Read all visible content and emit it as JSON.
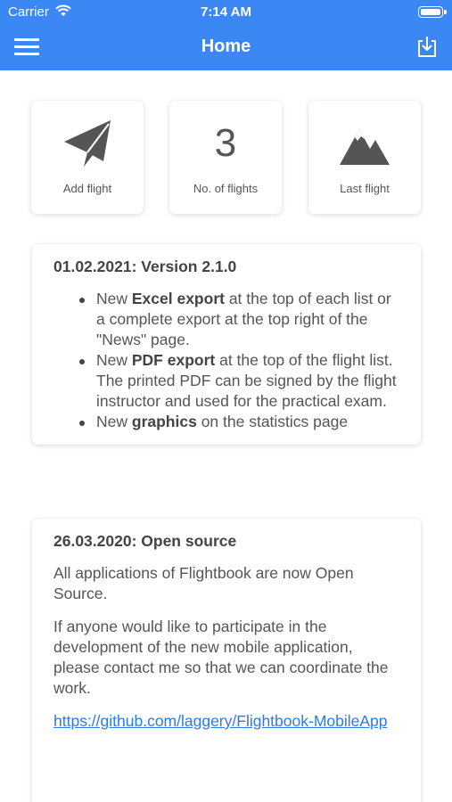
{
  "status_bar": {
    "carrier": "Carrier",
    "time": "7:14 AM"
  },
  "nav": {
    "title": "Home",
    "menu_icon": "hamburger-icon",
    "export_icon": "download-icon"
  },
  "tiles": [
    {
      "label": "Add flight",
      "icon": "paper-plane-icon"
    },
    {
      "label": "No. of flights",
      "count": "3"
    },
    {
      "label": "Last flight",
      "icon": "mountain-icon"
    }
  ],
  "news": [
    {
      "title": "01.02.2021: Version 2.1.0",
      "items": [
        {
          "pre": "New ",
          "bold": "Excel export",
          "post": " at the top of each list or a complete export at the top right of the \"News\" page."
        },
        {
          "pre": "New ",
          "bold": "PDF export",
          "post": " at the top of the flight list.",
          "extra": "The printed PDF can be signed by the flight instructor and used for the practical exam."
        },
        {
          "pre": "New ",
          "bold": "graphics",
          "post": " on the statistics page"
        }
      ]
    },
    {
      "title": "26.03.2020: Open source",
      "paragraphs": [
        "All applications of Flightbook are now Open Source.",
        "If anyone would like to participate in the development of the new mobile application, please contact me so that we can coordinate the work."
      ],
      "link": "https://github.com/laggery/Flightbook-MobileApp"
    }
  ]
}
